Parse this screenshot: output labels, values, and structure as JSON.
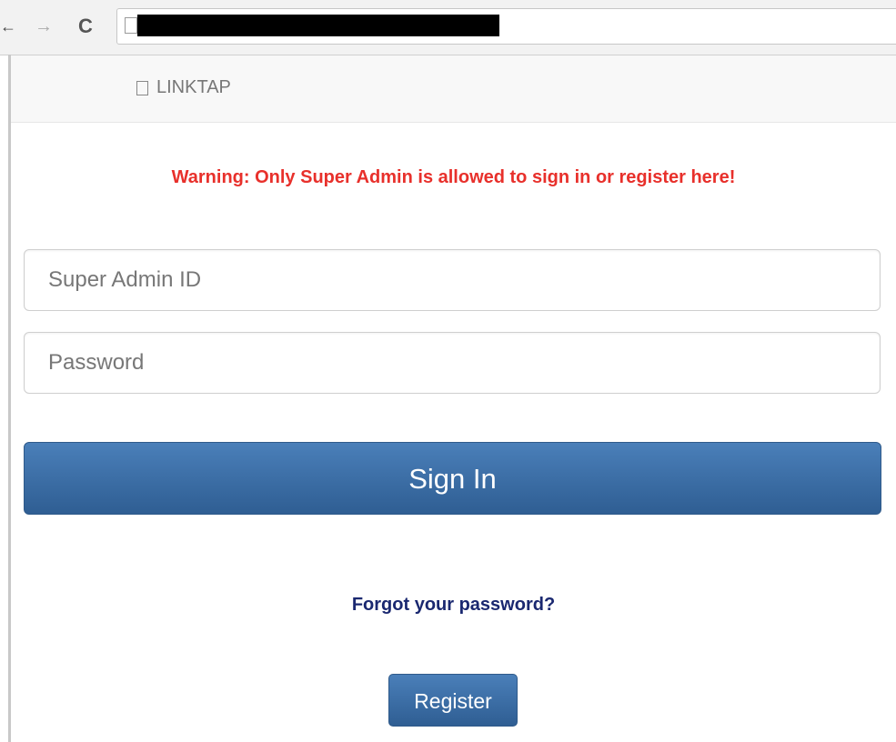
{
  "browser": {
    "back_glyph": "←",
    "forward_glyph": "→",
    "reload_glyph": "C",
    "icons": [
      "back-arrow-icon",
      "forward-arrow-icon",
      "reload-icon",
      "page-icon"
    ]
  },
  "navbar": {
    "brand": "LINKTAP"
  },
  "warning": "Warning: Only Super Admin is allowed to sign in or register here!",
  "form": {
    "id_placeholder": "Super Admin ID",
    "id_value": "",
    "password_placeholder": "Password",
    "password_value": "",
    "sign_in_label": "Sign In",
    "forgot_label": "Forgot your password?",
    "register_label": "Register"
  },
  "colors": {
    "warning": "#e8302b",
    "button": "#3a6ea5",
    "link": "#1a2870"
  }
}
